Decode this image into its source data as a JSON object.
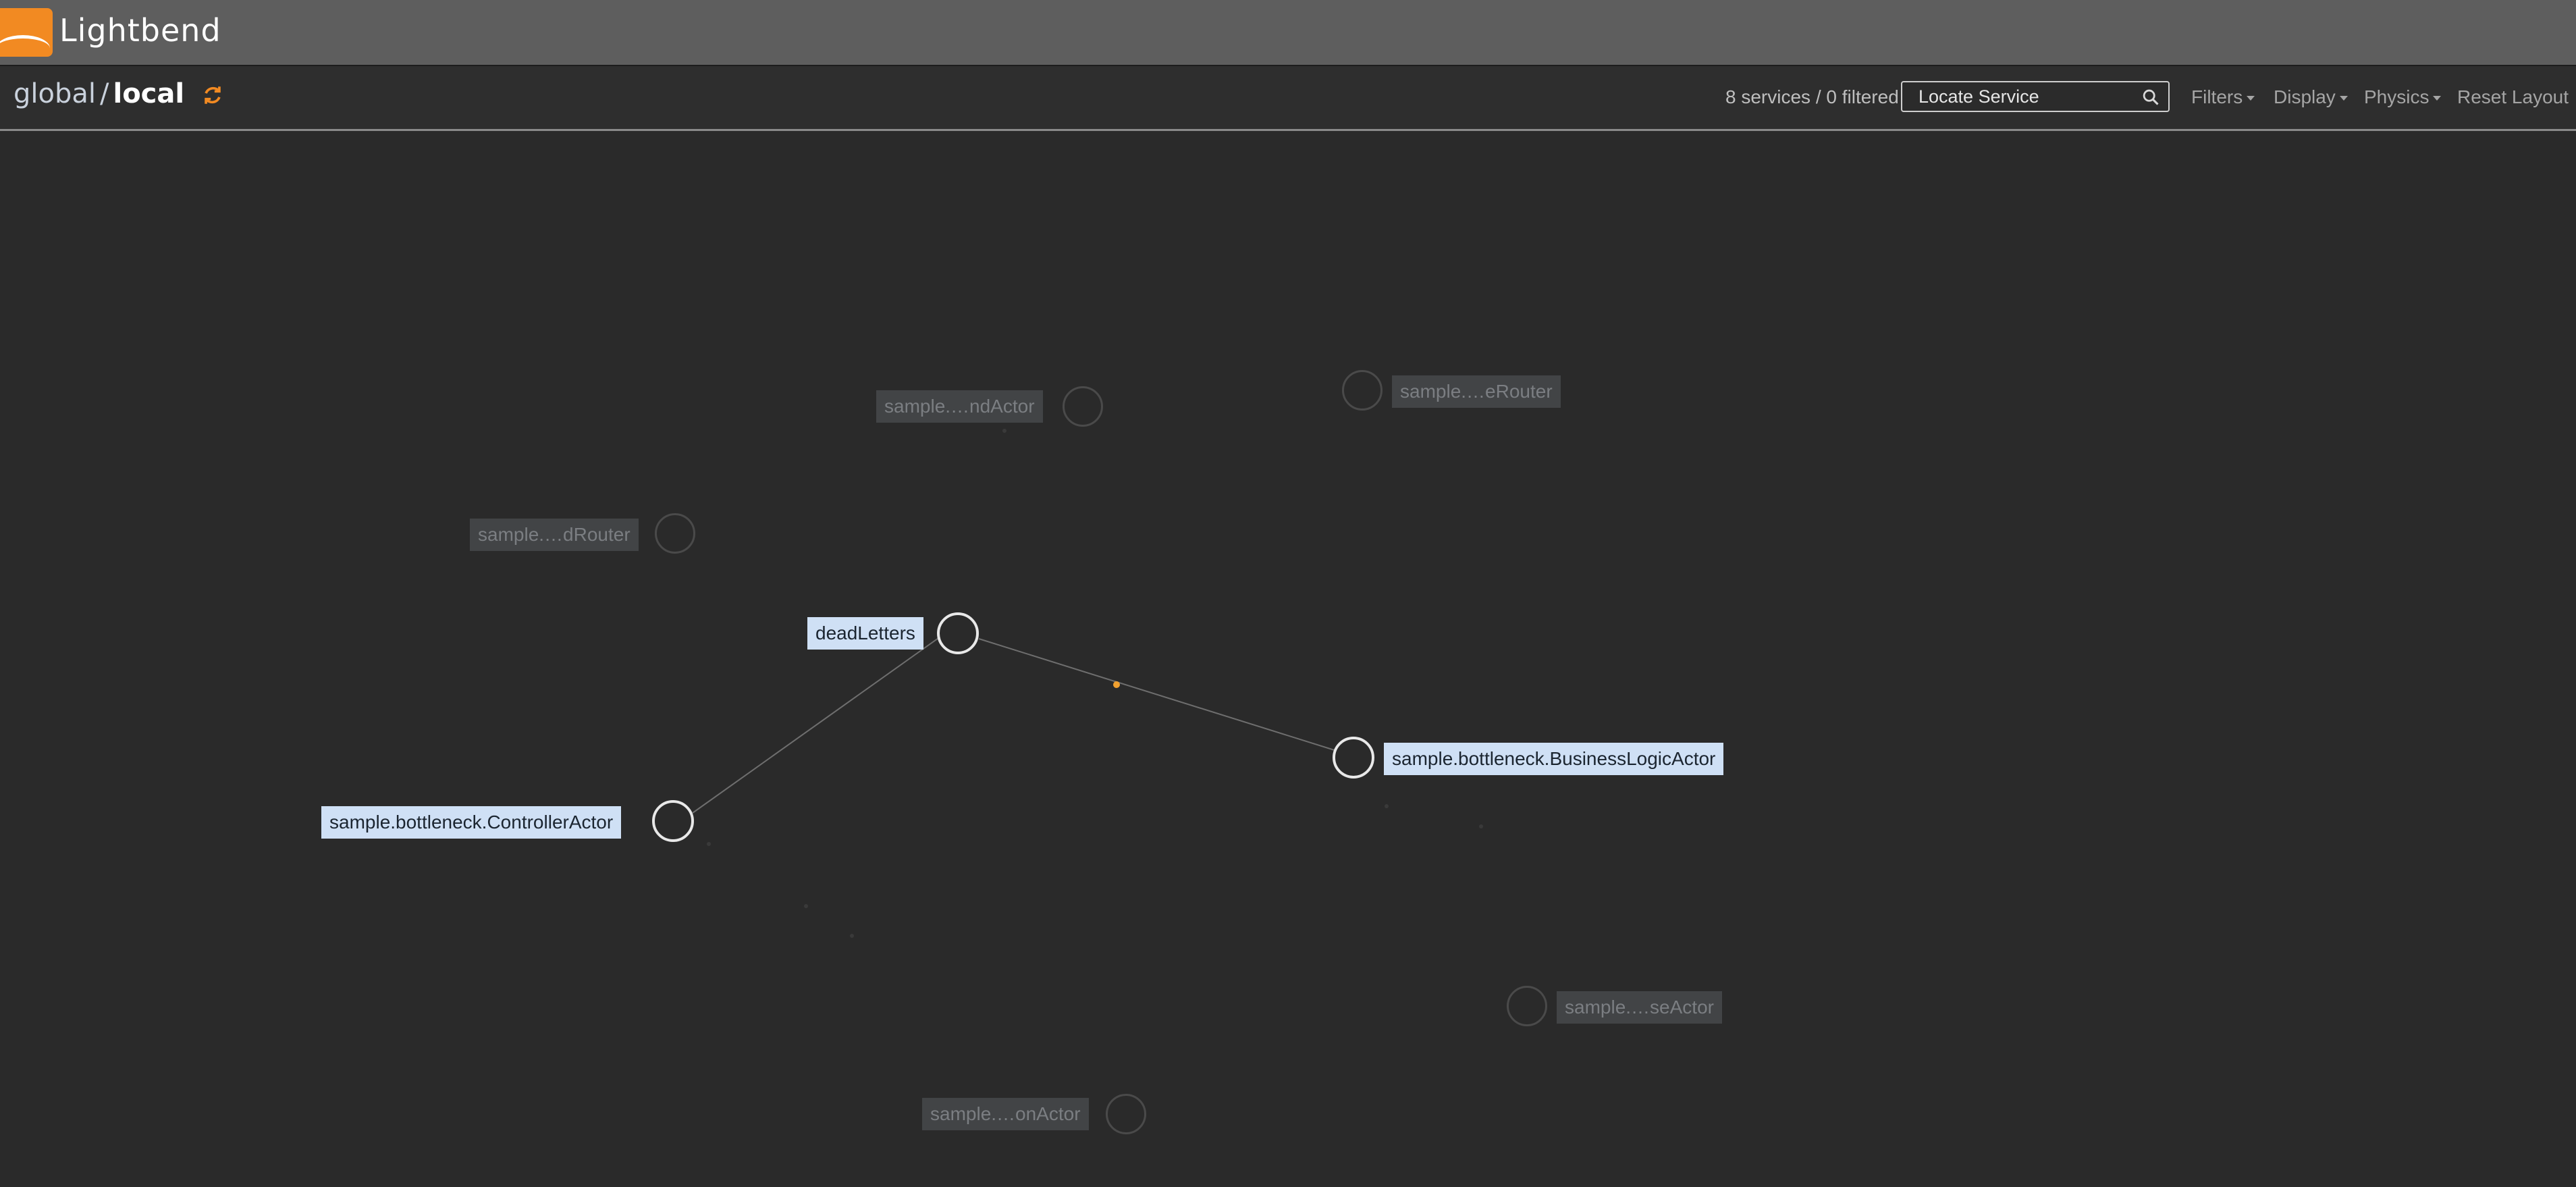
{
  "app": {
    "brand": "Lightbend",
    "brand_color": "#f28a22"
  },
  "breadcrumb": {
    "parent": "global",
    "separator": "/",
    "current": "local",
    "refresh_icon": "refresh-icon"
  },
  "toolbar": {
    "service_count": "8 services / 0 filtered",
    "search_placeholder": "Locate Service",
    "search_value": "",
    "filters": "Filters",
    "display": "Display",
    "physics": "Physics",
    "reset_layout": "Reset Layout"
  },
  "graph": {
    "active_color": "#cfe0f5",
    "message_dot_color": "#f0a030",
    "nodes": [
      {
        "id": "deadLetters",
        "label": "deadLetters",
        "state": "active"
      },
      {
        "id": "controller",
        "label": "sample.bottleneck.ControllerActor",
        "state": "active"
      },
      {
        "id": "business",
        "label": "sample.bottleneck.BusinessLogicActor",
        "state": "active"
      },
      {
        "id": "ndActor",
        "label": "sample.…ndActor",
        "state": "dimmed"
      },
      {
        "id": "eRouter",
        "label": "sample.…eRouter",
        "state": "dimmed"
      },
      {
        "id": "dRouter",
        "label": "sample.…dRouter",
        "state": "dimmed"
      },
      {
        "id": "seActor",
        "label": "sample.…seActor",
        "state": "dimmed"
      },
      {
        "id": "onActor",
        "label": "sample.…onActor",
        "state": "dimmed"
      }
    ],
    "edges": [
      {
        "from": "deadLetters",
        "to": "controller"
      },
      {
        "from": "deadLetters",
        "to": "business"
      }
    ]
  }
}
